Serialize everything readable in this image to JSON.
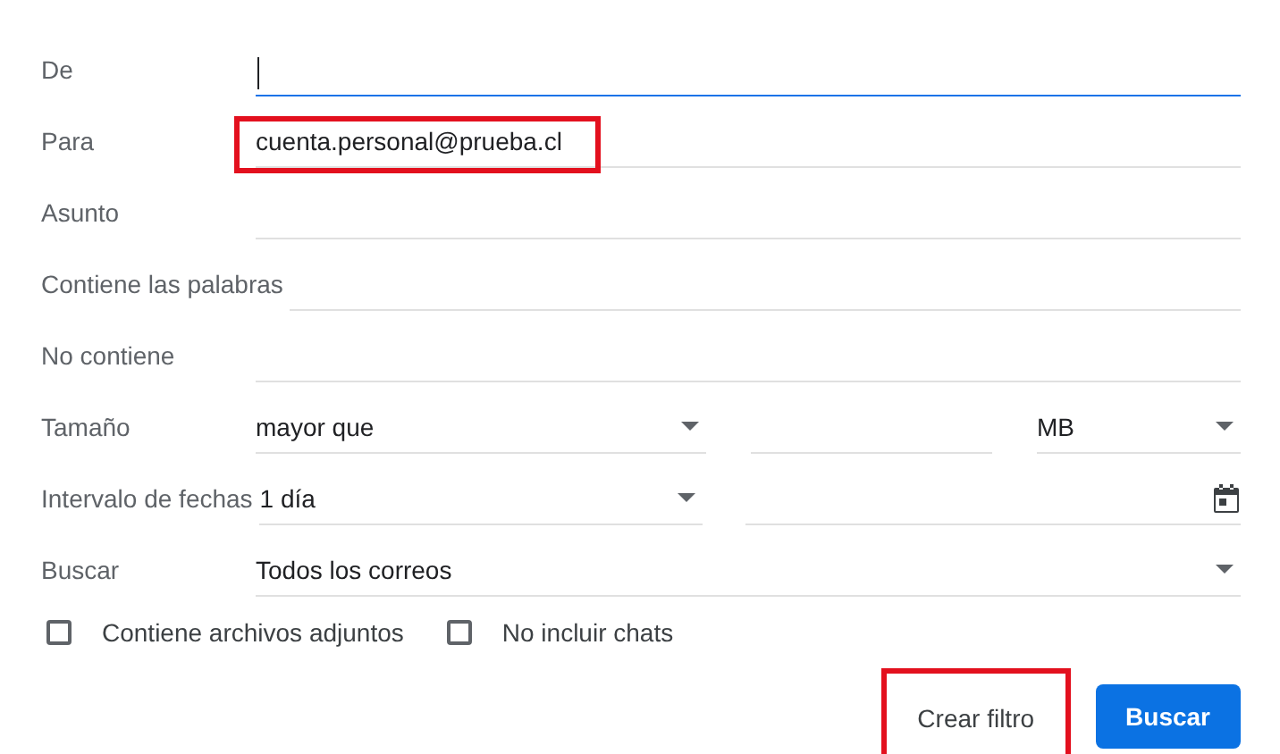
{
  "fields": [
    {
      "kind": "text",
      "label": "De",
      "focused": true,
      "highlighted": false
    },
    {
      "kind": "text",
      "label": "Para",
      "value": "cuenta.personal@prueba.cl",
      "focused": false,
      "highlighted": true
    },
    {
      "kind": "text",
      "label": "Asunto",
      "focused": false,
      "highlighted": false
    },
    {
      "kind": "text",
      "label": "Contiene las palabras",
      "focused": false,
      "highlighted": false
    },
    {
      "kind": "text",
      "label": "No contiene",
      "focused": false,
      "highlighted": false
    },
    {
      "kind": "size",
      "label": "Tamaño",
      "operator": "mayor que",
      "unit": "MB"
    },
    {
      "kind": "date",
      "label": "Intervalo de fechas",
      "range": "1 día"
    },
    {
      "kind": "select",
      "label": "Buscar",
      "value": "Todos los correos"
    }
  ],
  "checkboxes": [
    {
      "label": "Contiene archivos adjuntos",
      "checked": false
    },
    {
      "label": "No incluir chats",
      "checked": false
    }
  ],
  "buttons": [
    {
      "kind": "text",
      "label": "Crear filtro",
      "highlighted": true
    },
    {
      "kind": "primary",
      "label": "Buscar",
      "highlighted": false
    }
  ]
}
